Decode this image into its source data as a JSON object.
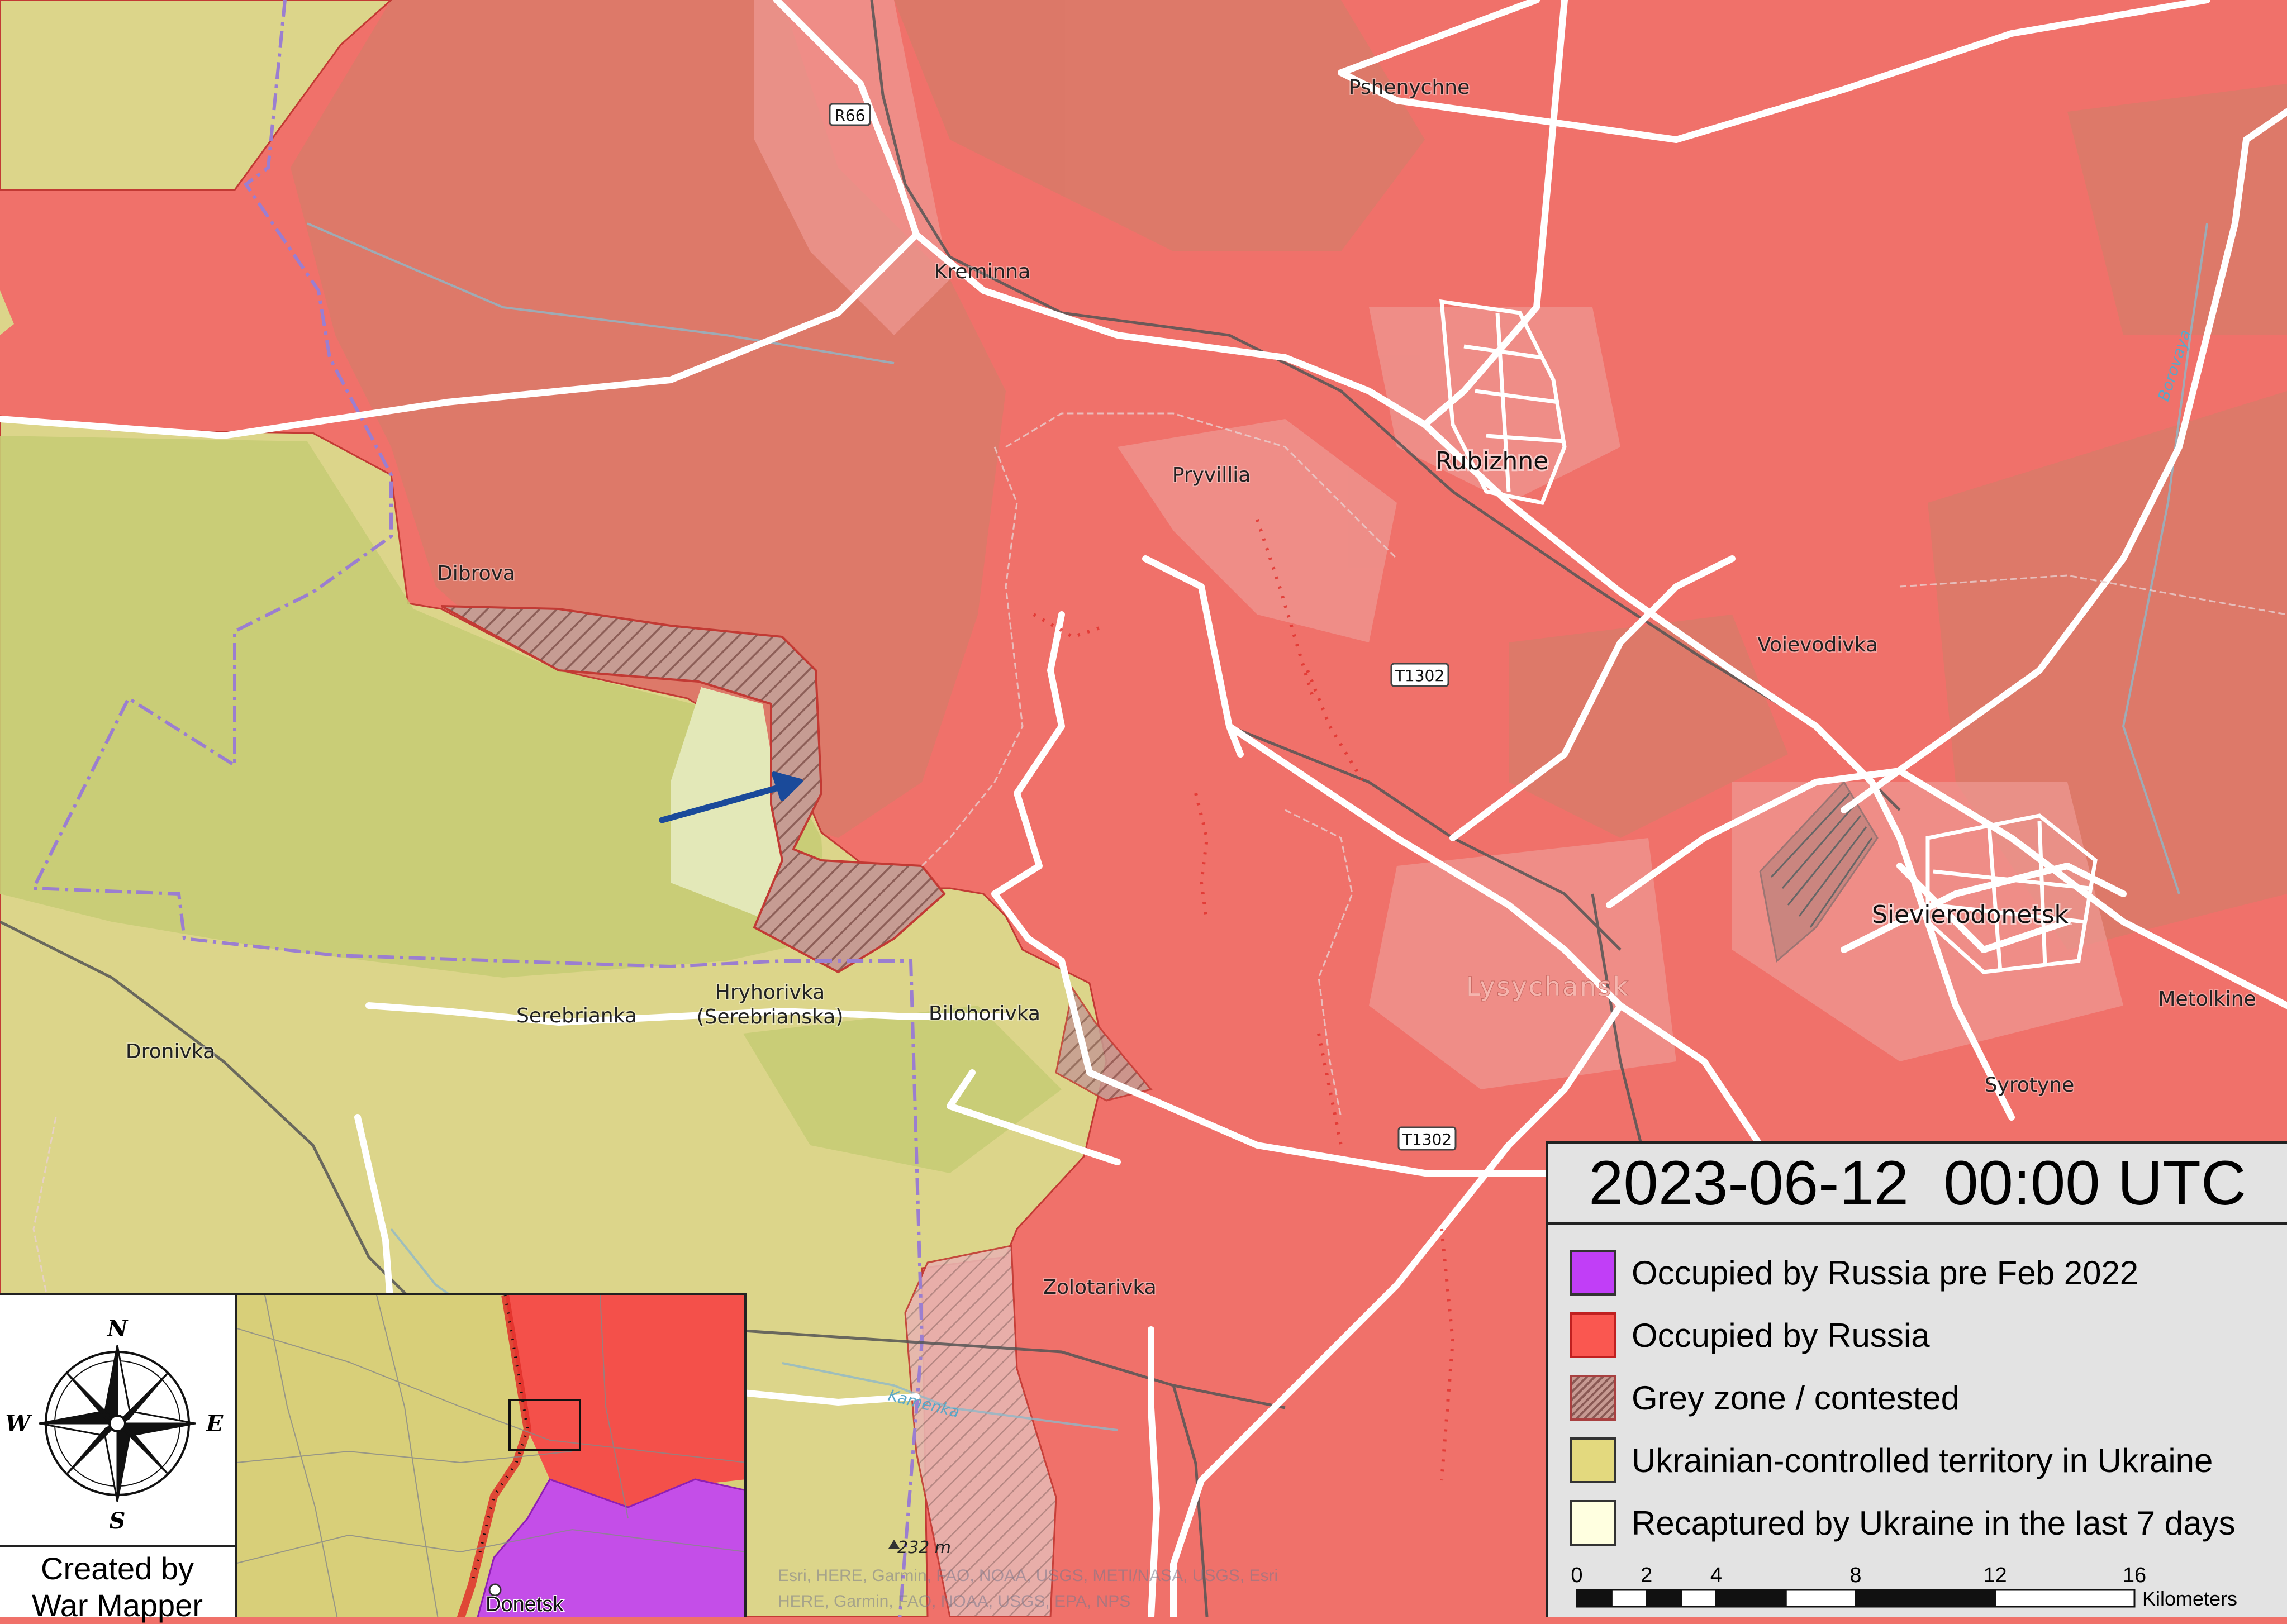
{
  "map": {
    "places": {
      "pshenychne": "Pshenychne",
      "kreminna": "Kreminna",
      "rubizhne": "Rubizhne",
      "pryvillia": "Pryvillia",
      "dibrova": "Dibrova",
      "voievodivka": "Voievodivka",
      "sievierodonetsk": "Sievierodonetsk",
      "lysychansk": "Lysychansk",
      "metolkine": "Metolkine",
      "syrotyne": "Syrotyne",
      "serebrianka": "Serebrianka",
      "hryhorivka_1": "Hryhorivka",
      "hryhorivka_2": "(Serebrianska)",
      "bilohorivka": "Bilohorivka",
      "dronivka": "Dronivka",
      "zolotarivka": "Zolotarivka"
    },
    "road_shields": {
      "r66": "R66",
      "t1302_a": "T1302",
      "t1302_b": "T1302"
    },
    "water_labels": {
      "borovaya": "Borovaya",
      "kamenka": "Kamenka"
    },
    "elevation_label": "232 m",
    "attribution_1": "Esri, HERE, Garmin, FAO, NOAA, USGS, METI/NASA, USGS, Esri",
    "attribution_2": "HERE, Garmin, FAO, NOAA, USGS, EPA, NPS"
  },
  "legend": {
    "timestamp": "2023-06-12  00:00 UTC",
    "items": [
      {
        "label": "Occupied by Russia pre Feb 2022",
        "color": "#c13ef7"
      },
      {
        "label": "Occupied by Russia",
        "color": "#fa5750"
      },
      {
        "label": "Grey zone / contested",
        "color": "#b98b84"
      },
      {
        "label": "Ukrainian-controlled territory in Ukraine",
        "color": "#e3d97e"
      },
      {
        "label": "Recaptured by Ukraine in the last 7 days",
        "color": "#ffffe0"
      }
    ],
    "scale": {
      "ticks": [
        "0",
        "2",
        "4",
        "8",
        "12",
        "16"
      ],
      "unit": "Kilometers"
    }
  },
  "compass": {
    "north": "N",
    "south": "S",
    "east": "E",
    "west": "W"
  },
  "credit": {
    "line1": "Created by",
    "line2": "War Mapper"
  },
  "inset": {
    "city_label": "Donetsk"
  },
  "colors": {
    "russia_occupied": "#f0716a",
    "russia_occupied_dark": "#d9756a",
    "ukraine_controlled": "#dcd58a",
    "ukraine_green": "#cdd27a",
    "recaptured": "#e3e8b8",
    "grey_zone": "#b98b84",
    "arrow": "#1a4a9a",
    "border_line": "#9b7ed0"
  }
}
